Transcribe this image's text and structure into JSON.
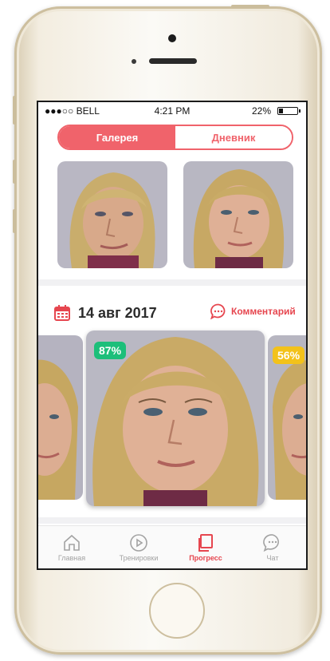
{
  "status_bar": {
    "carrier": "●●●○○ BELL",
    "time": "4:21 PM",
    "battery_text": "22%",
    "battery_level": 0.22
  },
  "segments": [
    {
      "label": "Галерея",
      "active": true
    },
    {
      "label": "Дневник",
      "active": false
    }
  ],
  "entry": {
    "date": "14 авг 2017",
    "comment_label": "Комментарий"
  },
  "scores": {
    "current": "87%",
    "next": "56%"
  },
  "tabs": [
    {
      "label": "Главная",
      "icon": "home-icon",
      "active": false
    },
    {
      "label": "Тренировки",
      "icon": "play-icon",
      "active": false
    },
    {
      "label": "Прогресс",
      "icon": "progress-icon",
      "active": true
    },
    {
      "label": "Чат",
      "icon": "chat-icon",
      "active": false
    }
  ],
  "colors": {
    "accent": "#f0636b",
    "good": "#1cbf7a",
    "medium": "#f3c21a",
    "inactive": "#a3a3a3"
  }
}
